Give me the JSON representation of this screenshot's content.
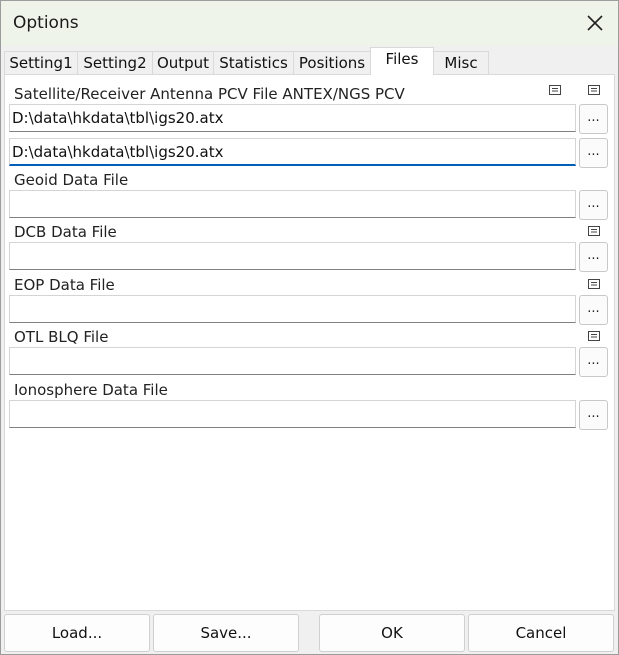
{
  "window": {
    "title": "Options"
  },
  "tabs": [
    {
      "label": "Setting1"
    },
    {
      "label": "Setting2"
    },
    {
      "label": "Output"
    },
    {
      "label": "Statistics"
    },
    {
      "label": "Positions"
    },
    {
      "label": "Files",
      "active": true
    },
    {
      "label": "Misc"
    }
  ],
  "files": {
    "antex_label": "Satellite/Receiver Antenna PCV File ANTEX/NGS PCV",
    "antex_satellite_value": "D:\\data\\hkdata\\tbl\\igs20.atx",
    "antex_receiver_value": "D:\\data\\hkdata\\tbl\\igs20.atx",
    "geoid_label": "Geoid Data File",
    "geoid_value": "",
    "dcb_label": "DCB Data File",
    "dcb_value": "",
    "eop_label": "EOP Data File",
    "eop_value": "",
    "otl_label": "OTL BLQ File",
    "otl_value": "",
    "iono_label": "Ionosphere Data File",
    "iono_value": "",
    "browse_label": "..."
  },
  "buttons": {
    "load": "Load...",
    "save": "Save...",
    "ok": "OK",
    "cancel": "Cancel"
  },
  "colors": {
    "titlebar": "#eef4ea",
    "focus_accent": "#005fb8"
  },
  "icons": [
    "close-icon",
    "view-file-icon"
  ]
}
